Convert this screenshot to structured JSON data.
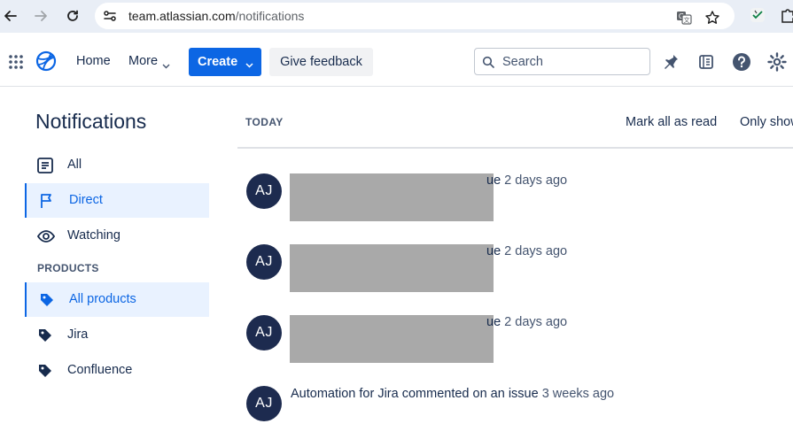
{
  "browser": {
    "url_host": "team.atlassian.com",
    "url_path": "/notifications"
  },
  "header": {
    "home_label": "Home",
    "more_label": "More",
    "create_label": "Create",
    "feedback_label": "Give feedback",
    "search_placeholder": "Search"
  },
  "sidebar": {
    "title": "Notifications",
    "items": [
      {
        "label": "All",
        "icon": "list-icon",
        "active": false
      },
      {
        "label": "Direct",
        "icon": "flag-icon",
        "active": true
      },
      {
        "label": "Watching",
        "icon": "eye-icon",
        "active": false
      }
    ],
    "section_label": "PRODUCTS",
    "products": [
      {
        "label": "All products",
        "icon": "tag-icon",
        "active": true
      },
      {
        "label": "Jira",
        "icon": "tag-icon",
        "active": false
      },
      {
        "label": "Confluence",
        "icon": "tag-icon",
        "active": false
      }
    ]
  },
  "main": {
    "section_label": "TODAY",
    "mark_all_read": "Mark all as read",
    "only_show": "Only show",
    "notifications": [
      {
        "initials": "AJ",
        "text_tail": "ue",
        "time": "2 days ago"
      },
      {
        "initials": "AJ",
        "text_tail": "ue",
        "time": "2 days ago"
      },
      {
        "initials": "AJ",
        "text_tail": "ue",
        "time": "2 days ago"
      },
      {
        "initials": "AJ",
        "text": "Automation for Jira commented on an issue",
        "time": "3 weeks ago"
      }
    ]
  },
  "colors": {
    "accent": "#0c66e4",
    "avatar_bg": "#1d2b4f",
    "active_bg": "#e9f2ff",
    "redaction": "#a9a9a9"
  }
}
